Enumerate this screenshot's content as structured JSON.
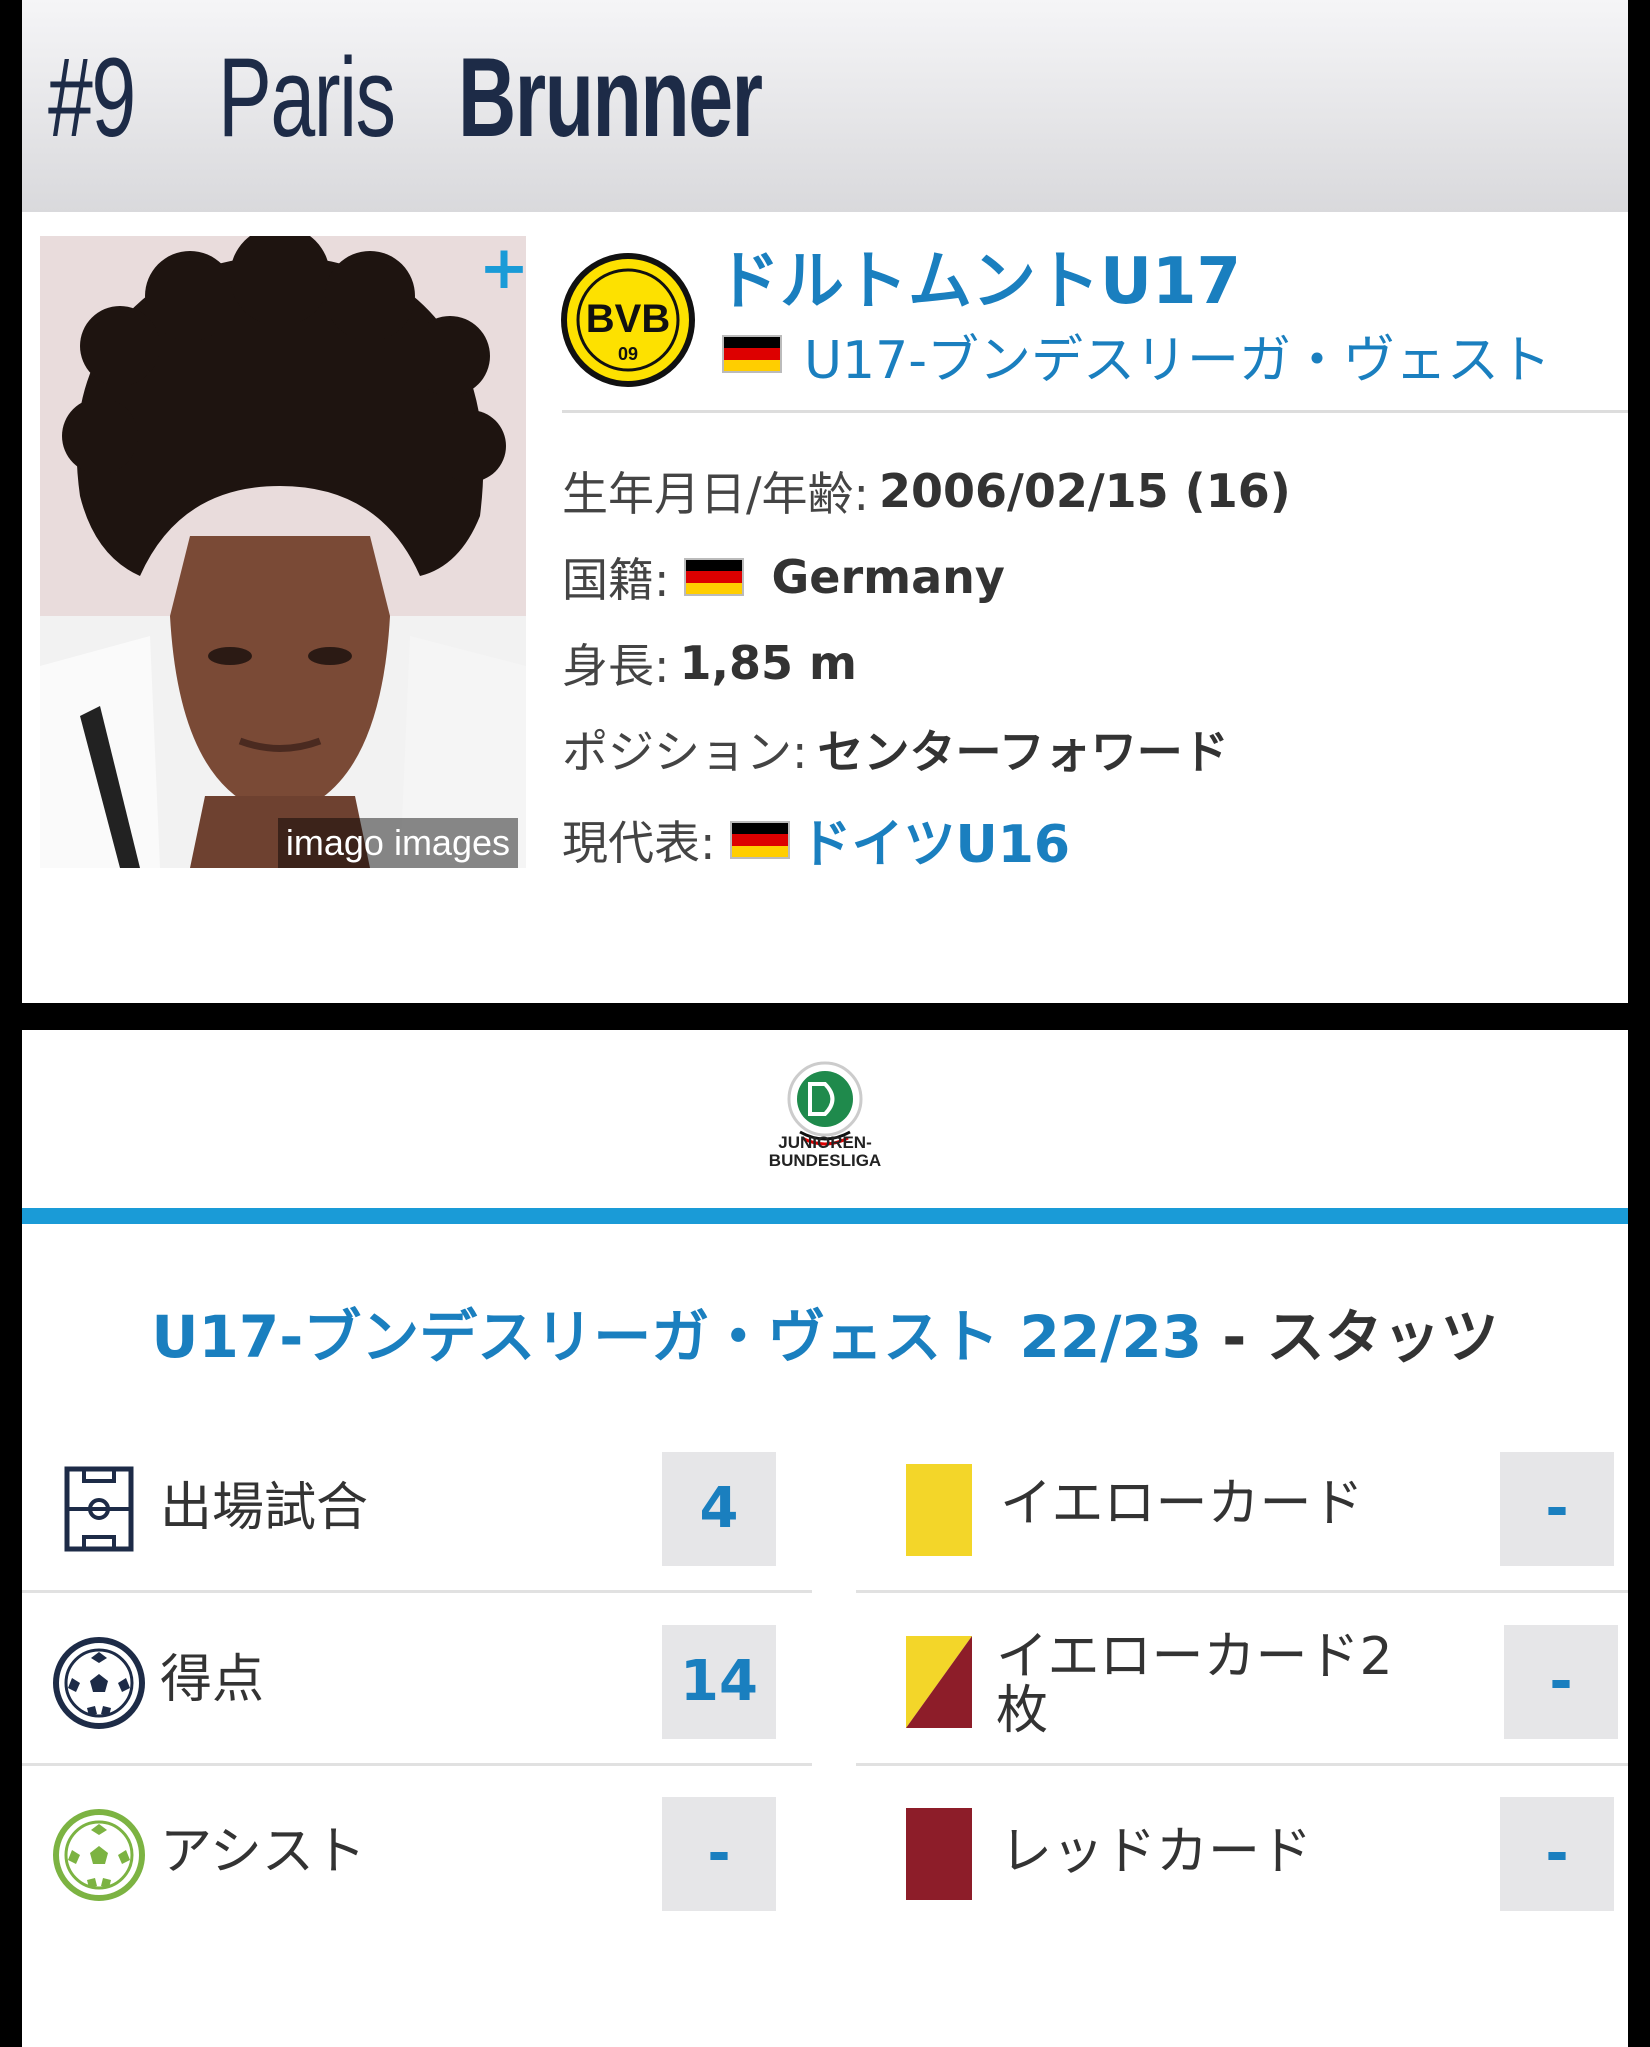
{
  "header": {
    "number": "#9",
    "first_name": "Paris",
    "last_name": "Brunner"
  },
  "photo": {
    "credit": "imago images",
    "plus": "+"
  },
  "club": {
    "name": "ドルトムントU17",
    "league": "U17-ブンデスリーガ・ヴェスト",
    "logo_text": "BVB",
    "logo_year": "09"
  },
  "info": [
    {
      "label": "生年月日/年齢:",
      "value": "2006/02/15 (16)"
    },
    {
      "label": "国籍:",
      "value": "Germany"
    },
    {
      "label": "身長:",
      "value": "1,85 m"
    },
    {
      "label": "ポジション:",
      "value": "センターフォワード"
    },
    {
      "label": "現代表:",
      "value": "ドイツU16"
    }
  ],
  "league_logo": {
    "line1": "JUNIOREN-",
    "line2": "BUNDESLIGA"
  },
  "stats_title": {
    "league": "U17-ブンデスリーガ・ヴェスト 22/23",
    "sep": " - ",
    "suffix": "スタッツ"
  },
  "stats_left": [
    {
      "label": "出場試合",
      "value": "4",
      "icon": "pitch-icon"
    },
    {
      "label": "得点",
      "value": "14",
      "icon": "ball-icon"
    },
    {
      "label": "アシスト",
      "value": "-",
      "icon": "assist-ball-icon"
    }
  ],
  "stats_right": [
    {
      "label": "イエローカード",
      "value": "-",
      "icon": "yellow-card-icon"
    },
    {
      "label": "イエローカード2枚",
      "label_line1": "イエローカード2",
      "label_line2": "枚",
      "value": "-",
      "icon": "yellow-red-card-icon"
    },
    {
      "label": "レッドカード",
      "value": "-",
      "icon": "red-card-icon"
    }
  ],
  "colors": {
    "accent": "#1a7fbf",
    "bar": "#1a9bd7",
    "yellow": "#f3d629",
    "red": "#8d1d29",
    "navy": "#1d2b47"
  }
}
